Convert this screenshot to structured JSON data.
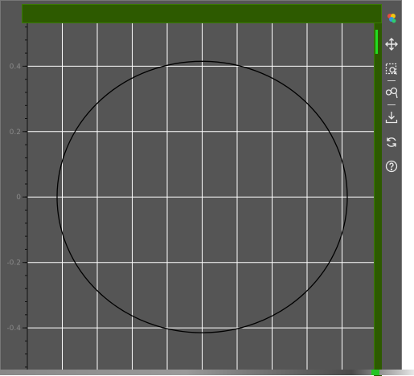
{
  "plot": {
    "y_tick_labels": [
      {
        "value": 0.4,
        "label": "0.4"
      },
      {
        "value": 0.2,
        "label": "0.2"
      },
      {
        "value": 0,
        "label": "0"
      },
      {
        "value": -0.2,
        "label": "-0.2"
      },
      {
        "value": -0.4,
        "label": "-0.4"
      }
    ],
    "x_range": [
      -0.5,
      0.5
    ],
    "y_range": [
      -0.53,
      0.6
    ],
    "circle": {
      "center_x": 0,
      "center_y": 0,
      "radius": 0.415
    },
    "grid": true,
    "colors": {
      "background": "#555555",
      "grid": "#ffffff",
      "circle": "#000000",
      "highlight": "#2d5a00"
    }
  },
  "toolbar": {
    "tools": [
      {
        "name": "bokeh-logo",
        "icon": "logo-icon"
      },
      {
        "name": "pan-tool",
        "icon": "pan-icon"
      },
      {
        "name": "box-zoom-tool",
        "icon": "box-zoom-icon"
      },
      {
        "name": "wheel-zoom-tool",
        "icon": "wheel-zoom-icon"
      },
      {
        "name": "save-tool",
        "icon": "save-icon"
      },
      {
        "name": "reset-tool",
        "icon": "reset-icon"
      },
      {
        "name": "help-tool",
        "icon": "help-icon"
      }
    ]
  }
}
